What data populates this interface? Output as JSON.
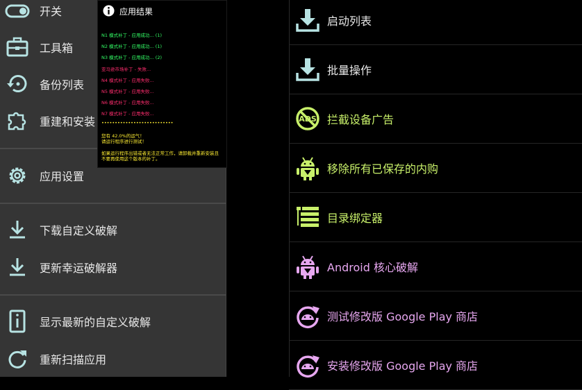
{
  "drawer": {
    "items": [
      {
        "label": "开关",
        "icon": "toggle-icon"
      },
      {
        "label": "工具箱",
        "icon": "toolbox-icon"
      },
      {
        "label": "备份列表",
        "icon": "backup-restore-icon"
      },
      {
        "label": "重建和安装",
        "icon": "puzzle-icon"
      },
      {
        "label": "应用设置",
        "icon": "gear-icon"
      },
      {
        "label": "下载自定义破解",
        "icon": "download-icon"
      },
      {
        "label": "更新幸运破解器",
        "icon": "download-icon"
      },
      {
        "label": "显示最新的自定义破解",
        "icon": "document-info-icon"
      },
      {
        "label": "重新扫描应用",
        "icon": "refresh-icon"
      }
    ]
  },
  "main": {
    "rows": [
      {
        "label": "启动列表",
        "icon": "download-tray-icon"
      },
      {
        "label": "批量操作",
        "icon": "download-tray-icon"
      },
      {
        "label": "拦截设备广告",
        "icon": "ads-block-icon"
      },
      {
        "label": "移除所有已保存的内购",
        "icon": "android-download-icon"
      },
      {
        "label": "目录绑定器",
        "icon": "list-binder-icon"
      },
      {
        "label": "Android 核心破解",
        "icon": "android-download-icon"
      },
      {
        "label": "测试修改版 Google Play 商店",
        "icon": "android-refresh-icon"
      },
      {
        "label": "安装修改版 Google Play 商店",
        "icon": "android-refresh-icon"
      }
    ]
  },
  "dialog": {
    "title": "应用结果",
    "lines": [
      {
        "text": "N1 模式补丁 - 应用成功... (1)",
        "color": "green"
      },
      {
        "text": "N2 模式补丁 - 应用成功... (1)",
        "color": "green"
      },
      {
        "text": "N3 模式补丁 - 应用成功... (2)",
        "color": "green"
      },
      {
        "text": "亚马逊市场补丁 - 失败...",
        "color": "red"
      },
      {
        "text": "N4 模式补丁 - 应用失败...",
        "color": "red"
      },
      {
        "text": "N5 模式补丁 - 应用失败...",
        "color": "red"
      },
      {
        "text": "N6 模式补丁 - 应用失败...",
        "color": "red"
      },
      {
        "text": "N7 模式补丁 - 应用失败...",
        "color": "red"
      },
      {
        "text": "•••••••••••••••••••••••••••",
        "color": "yellow"
      },
      {
        "text": "您有 42.0%的运气！",
        "color": "yellow"
      },
      {
        "text": "请运行程序进行测试！",
        "color": "yellow"
      },
      {
        "text": "如果运行程序出错或者无法正常工作，请卸载并重新安装且",
        "color": "yellow"
      },
      {
        "text": "不要再使用这个版本的补丁。",
        "color": "yellow"
      }
    ]
  },
  "colors": {
    "drawer_bg": "#353535",
    "accent_green": "#c8f06a",
    "accent_pink": "#e7a7f0",
    "icon_teal": "#b7e3e3"
  }
}
